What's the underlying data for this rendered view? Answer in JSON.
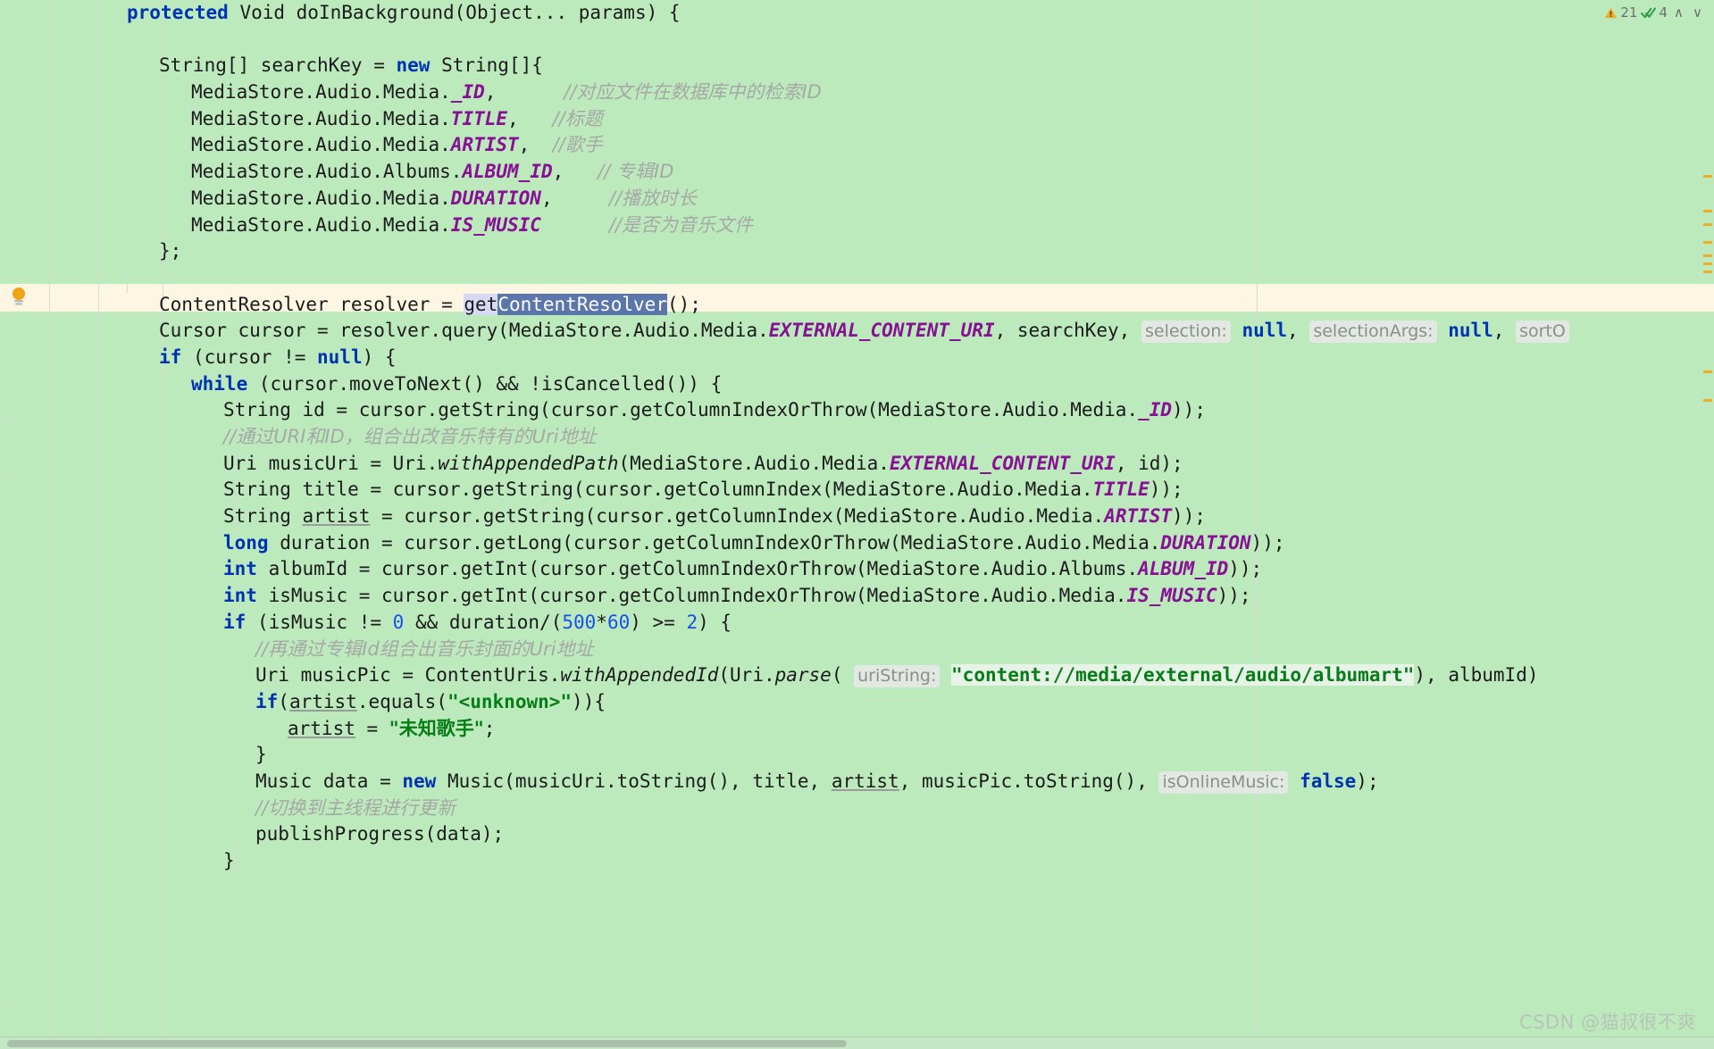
{
  "app": {
    "kind": "ide-code-editor",
    "language": "Java",
    "theme_background": "#bdeabd",
    "current_line_background": "#fdf6e3"
  },
  "inspection_widget": {
    "warning_icon": "warning-triangle-icon",
    "warning_count": "21",
    "check_icon": "double-check-icon",
    "check_count": "4",
    "prev_label": "∧",
    "next_label": "∨",
    "warning_color": "#f0ad24",
    "check_color": "#2f9e44"
  },
  "gutter": {
    "bulb_icon": "lightbulb-intention-icon",
    "bulb_color": "#f0a419"
  },
  "scrollbar": {
    "marker_color": "#f0ad24",
    "marker_positions": [
      196,
      235,
      250,
      270,
      285,
      294,
      303,
      415,
      447
    ],
    "thumb_name": "horizontal-scrollbar-thumb"
  },
  "watermark": {
    "text": "CSDN @猫叔很不爽"
  },
  "code": {
    "lines": [
      {
        "id": "l1",
        "indent": 0,
        "tokens": [
          {
            "t": "kw",
            "v": "protected"
          },
          {
            "t": "plain",
            "v": " Void doInBackground(Object... params) {"
          }
        ]
      },
      {
        "id": "l2",
        "indent": 0,
        "tokens": []
      },
      {
        "id": "l3",
        "indent": 1,
        "tokens": [
          {
            "t": "plain",
            "v": "String[] searchKey = "
          },
          {
            "t": "kw",
            "v": "new"
          },
          {
            "t": "plain",
            "v": " String[]{"
          }
        ]
      },
      {
        "id": "l4",
        "indent": 2,
        "tokens": [
          {
            "t": "plain",
            "v": "MediaStore.Audio.Media."
          },
          {
            "t": "static",
            "v": "_ID"
          },
          {
            "t": "plain",
            "v": ","
          },
          {
            "t": "plain",
            "v": "      "
          },
          {
            "t": "cmt-cn",
            "v": "//对应文件在数据库中的检索ID"
          }
        ]
      },
      {
        "id": "l5",
        "indent": 2,
        "tokens": [
          {
            "t": "plain",
            "v": "MediaStore.Audio.Media."
          },
          {
            "t": "static",
            "v": "TITLE"
          },
          {
            "t": "plain",
            "v": ","
          },
          {
            "t": "plain",
            "v": "   "
          },
          {
            "t": "cmt-cn",
            "v": "//标题"
          }
        ]
      },
      {
        "id": "l6",
        "indent": 2,
        "tokens": [
          {
            "t": "plain",
            "v": "MediaStore.Audio.Media."
          },
          {
            "t": "static",
            "v": "ARTIST"
          },
          {
            "t": "plain",
            "v": ","
          },
          {
            "t": "plain",
            "v": "  "
          },
          {
            "t": "cmt-cn",
            "v": "//歌手"
          }
        ]
      },
      {
        "id": "l7",
        "indent": 2,
        "tokens": [
          {
            "t": "plain",
            "v": "MediaStore.Audio.Albums."
          },
          {
            "t": "static",
            "v": "ALBUM_ID"
          },
          {
            "t": "plain",
            "v": ","
          },
          {
            "t": "plain",
            "v": "   "
          },
          {
            "t": "cmt-cn",
            "v": "// 专辑ID"
          }
        ]
      },
      {
        "id": "l8",
        "indent": 2,
        "tokens": [
          {
            "t": "plain",
            "v": "MediaStore.Audio.Media."
          },
          {
            "t": "static",
            "v": "DURATION"
          },
          {
            "t": "plain",
            "v": ","
          },
          {
            "t": "plain",
            "v": "     "
          },
          {
            "t": "cmt-cn",
            "v": "//播放时长"
          }
        ]
      },
      {
        "id": "l9",
        "indent": 2,
        "tokens": [
          {
            "t": "plain",
            "v": "MediaStore.Audio.Media."
          },
          {
            "t": "static",
            "v": "IS_MUSIC"
          },
          {
            "t": "plain",
            "v": "      "
          },
          {
            "t": "cmt-cn",
            "v": "//是否为音乐文件"
          }
        ]
      },
      {
        "id": "l10",
        "indent": 1,
        "tokens": [
          {
            "t": "plain",
            "v": "};"
          }
        ]
      },
      {
        "id": "l11",
        "indent": 0,
        "tokens": []
      },
      {
        "id": "l12",
        "indent": 1,
        "current": true,
        "tokens": [
          {
            "t": "plain",
            "v": "ContentResolver resolver = "
          },
          {
            "t": "sel-soft",
            "v": "get"
          },
          {
            "t": "sel-strong",
            "v": "ContentResolver"
          },
          {
            "t": "plain",
            "v": "();"
          }
        ]
      },
      {
        "id": "l13",
        "indent": 1,
        "tokens": [
          {
            "t": "plain",
            "v": "Cursor cursor = resolver.query(MediaStore.Audio.Media."
          },
          {
            "t": "static",
            "v": "EXTERNAL_CONTENT_URI"
          },
          {
            "t": "plain",
            "v": ", searchKey, "
          },
          {
            "t": "hint",
            "v": "selection:"
          },
          {
            "t": "plain",
            "v": " "
          },
          {
            "t": "kw",
            "v": "null"
          },
          {
            "t": "plain",
            "v": ", "
          },
          {
            "t": "hint",
            "v": "selectionArgs:"
          },
          {
            "t": "plain",
            "v": " "
          },
          {
            "t": "kw",
            "v": "null"
          },
          {
            "t": "plain",
            "v": ", "
          },
          {
            "t": "hint",
            "v": "sortO"
          }
        ]
      },
      {
        "id": "l14",
        "indent": 1,
        "tokens": [
          {
            "t": "kw",
            "v": "if"
          },
          {
            "t": "plain",
            "v": " (cursor != "
          },
          {
            "t": "kw",
            "v": "null"
          },
          {
            "t": "plain",
            "v": ") {"
          }
        ]
      },
      {
        "id": "l15",
        "indent": 2,
        "tokens": [
          {
            "t": "kw",
            "v": "while"
          },
          {
            "t": "plain",
            "v": " (cursor.moveToNext() && !isCancelled()) {"
          }
        ]
      },
      {
        "id": "l16",
        "indent": 3,
        "tokens": [
          {
            "t": "plain",
            "v": "String id = cursor.getString(cursor.getColumnIndexOrThrow(MediaStore.Audio.Media."
          },
          {
            "t": "static",
            "v": "_ID"
          },
          {
            "t": "plain",
            "v": "));"
          }
        ]
      },
      {
        "id": "l17",
        "indent": 3,
        "tokens": [
          {
            "t": "cmt-cn",
            "v": "//通过URI和ID，组合出改音乐特有的Uri地址"
          }
        ]
      },
      {
        "id": "l18",
        "indent": 3,
        "tokens": [
          {
            "t": "plain",
            "v": "Uri musicUri = Uri."
          },
          {
            "t": "method",
            "v": "withAppendedPath"
          },
          {
            "t": "plain",
            "v": "(MediaStore.Audio.Media."
          },
          {
            "t": "static",
            "v": "EXTERNAL_CONTENT_URI"
          },
          {
            "t": "plain",
            "v": ", id);"
          }
        ]
      },
      {
        "id": "l19",
        "indent": 3,
        "tokens": [
          {
            "t": "plain",
            "v": "String title = cursor.getString(cursor.getColumnIndex(MediaStore.Audio.Media."
          },
          {
            "t": "static",
            "v": "TITLE"
          },
          {
            "t": "plain",
            "v": "));"
          }
        ]
      },
      {
        "id": "l20",
        "indent": 3,
        "tokens": [
          {
            "t": "plain",
            "v": "String "
          },
          {
            "t": "under",
            "v": "artist"
          },
          {
            "t": "plain",
            "v": " = cursor.getString(cursor.getColumnIndex(MediaStore.Audio.Media."
          },
          {
            "t": "static",
            "v": "ARTIST"
          },
          {
            "t": "plain",
            "v": "));"
          }
        ]
      },
      {
        "id": "l21",
        "indent": 3,
        "tokens": [
          {
            "t": "kw",
            "v": "long"
          },
          {
            "t": "plain",
            "v": " duration = cursor.getLong(cursor.getColumnIndexOrThrow(MediaStore.Audio.Media."
          },
          {
            "t": "static",
            "v": "DURATION"
          },
          {
            "t": "plain",
            "v": "));"
          }
        ]
      },
      {
        "id": "l22",
        "indent": 3,
        "tokens": [
          {
            "t": "kw",
            "v": "int"
          },
          {
            "t": "plain",
            "v": " albumId = cursor.getInt(cursor.getColumnIndexOrThrow(MediaStore.Audio.Albums."
          },
          {
            "t": "static",
            "v": "ALBUM_ID"
          },
          {
            "t": "plain",
            "v": "));"
          }
        ]
      },
      {
        "id": "l23",
        "indent": 3,
        "tokens": [
          {
            "t": "kw",
            "v": "int"
          },
          {
            "t": "plain",
            "v": " isMusic = cursor.getInt(cursor.getColumnIndexOrThrow(MediaStore.Audio.Media."
          },
          {
            "t": "static",
            "v": "IS_MUSIC"
          },
          {
            "t": "plain",
            "v": "));"
          }
        ]
      },
      {
        "id": "l24",
        "indent": 3,
        "tokens": [
          {
            "t": "kw",
            "v": "if"
          },
          {
            "t": "plain",
            "v": " (isMusic != "
          },
          {
            "t": "num",
            "v": "0"
          },
          {
            "t": "plain",
            "v": " && duration/("
          },
          {
            "t": "num",
            "v": "500"
          },
          {
            "t": "plain",
            "v": "*"
          },
          {
            "t": "num",
            "v": "60"
          },
          {
            "t": "plain",
            "v": ") >= "
          },
          {
            "t": "num",
            "v": "2"
          },
          {
            "t": "plain",
            "v": ") {"
          }
        ]
      },
      {
        "id": "l25",
        "indent": 4,
        "tokens": [
          {
            "t": "cmt-cn",
            "v": "//再通过专辑Id组合出音乐封面的Uri地址"
          }
        ]
      },
      {
        "id": "l26",
        "indent": 4,
        "tokens": [
          {
            "t": "plain",
            "v": "Uri musicPic = ContentUris."
          },
          {
            "t": "method",
            "v": "withAppendedId"
          },
          {
            "t": "plain",
            "v": "(Uri."
          },
          {
            "t": "method",
            "v": "parse"
          },
          {
            "t": "plain",
            "v": "( "
          },
          {
            "t": "hint",
            "v": "uriString:"
          },
          {
            "t": "plain",
            "v": " "
          },
          {
            "t": "str-bg",
            "v": "\"content://media/external/audio/albumart\""
          },
          {
            "t": "plain",
            "v": "), albumId)"
          }
        ]
      },
      {
        "id": "l27",
        "indent": 4,
        "tokens": [
          {
            "t": "kw",
            "v": "if"
          },
          {
            "t": "plain",
            "v": "("
          },
          {
            "t": "under",
            "v": "artist"
          },
          {
            "t": "plain",
            "v": ".equals("
          },
          {
            "t": "str",
            "v": "\"<unknown>\""
          },
          {
            "t": "plain",
            "v": ")){"
          }
        ]
      },
      {
        "id": "l28",
        "indent": 5,
        "tokens": [
          {
            "t": "under",
            "v": "artist"
          },
          {
            "t": "plain",
            "v": " = "
          },
          {
            "t": "str-cn",
            "v": "\"未知歌手\""
          },
          {
            "t": "plain",
            "v": ";"
          }
        ]
      },
      {
        "id": "l29",
        "indent": 4,
        "tokens": [
          {
            "t": "plain",
            "v": "}"
          }
        ]
      },
      {
        "id": "l30",
        "indent": 4,
        "tokens": [
          {
            "t": "plain",
            "v": "Music data = "
          },
          {
            "t": "kw",
            "v": "new"
          },
          {
            "t": "plain",
            "v": " Music(musicUri.toString(), title, "
          },
          {
            "t": "under",
            "v": "artist"
          },
          {
            "t": "plain",
            "v": ", musicPic.toString(), "
          },
          {
            "t": "hint",
            "v": "isOnlineMusic:"
          },
          {
            "t": "plain",
            "v": " "
          },
          {
            "t": "kw",
            "v": "false"
          },
          {
            "t": "plain",
            "v": ");"
          }
        ]
      },
      {
        "id": "l31",
        "indent": 4,
        "tokens": [
          {
            "t": "cmt-cn",
            "v": "//切换到主线程进行更新"
          }
        ]
      },
      {
        "id": "l32",
        "indent": 4,
        "tokens": [
          {
            "t": "plain",
            "v": "publishProgress(data);"
          }
        ]
      },
      {
        "id": "l33",
        "indent": 3,
        "tokens": [
          {
            "t": "plain",
            "v": "}"
          }
        ]
      }
    ]
  }
}
